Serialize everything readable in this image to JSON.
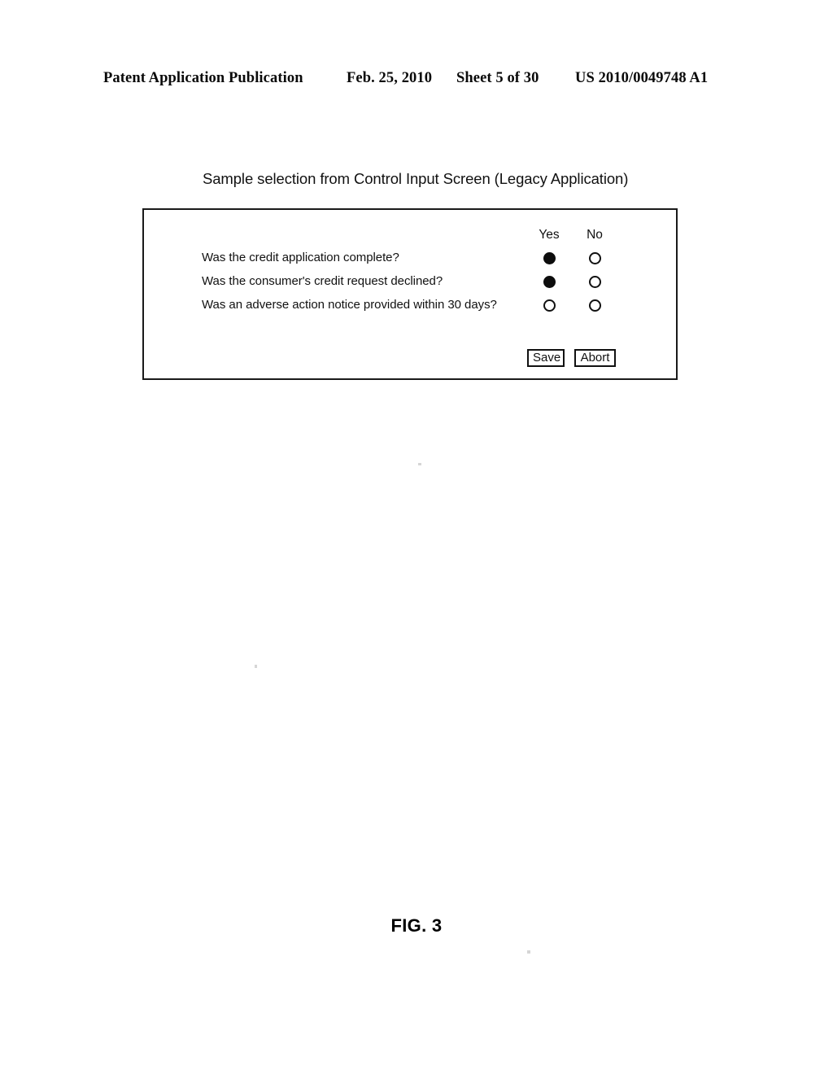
{
  "page_header": {
    "publication": "Patent Application Publication",
    "date": "Feb. 25, 2010",
    "sheet": "Sheet 5 of 30",
    "publication_number": "US 2010/0049748 A1"
  },
  "figure": {
    "title": "Sample selection from Control Input Screen (Legacy Application)",
    "caption": "FIG. 3"
  },
  "screen": {
    "columns": [
      {
        "label": "Yes",
        "key": "yes"
      },
      {
        "label": "No",
        "key": "no"
      }
    ],
    "questions": [
      {
        "label": "Was the credit application complete?",
        "yes_selected": true,
        "no_selected": false
      },
      {
        "label": "Was the consumer's credit request declined?",
        "yes_selected": true,
        "no_selected": false
      },
      {
        "label": "Was an adverse action notice provided within 30 days?",
        "yes_selected": false,
        "no_selected": false
      }
    ],
    "buttons": {
      "save_label": "Save",
      "abort_label": "Abort"
    }
  },
  "colors": {
    "ink": "#111111",
    "page_background": "#ffffff",
    "border": "#1a1a1a"
  }
}
